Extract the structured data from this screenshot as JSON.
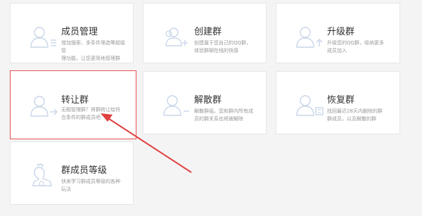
{
  "cards": [
    {
      "title": "成员管理",
      "desc": "增加搜索、多条件筛选等超级管\n理功能，让您更简地管理群"
    },
    {
      "title": "创建群",
      "desc": "创建属于您自己的QQ群，\n体验群聊在线的快感"
    },
    {
      "title": "升级群",
      "desc": "升级您的QQ群，吸纳更多\n成员加入"
    },
    {
      "title": "转让群",
      "desc": "无暇管理群？将群转让给符\n合条件的群成员吧"
    },
    {
      "title": "解散群",
      "desc": "解散群组。您和群内所有成\n员的群关系也将被解除"
    },
    {
      "title": "恢复群",
      "desc": "找回最近28天内删除的群\n群成员，以及解散的群"
    },
    {
      "title": "群成员等级",
      "desc": "快来学习群成员等级的各种\n玩法"
    }
  ],
  "colors": {
    "icon": "#c9d6e8",
    "highlight_border": "#e85050",
    "arrow": "#e04040"
  },
  "icons": [
    "user-list-icon",
    "user-add-icon",
    "user-upgrade-icon",
    "user-transfer-icon",
    "user-remove-icon",
    "user-restore-icon",
    "user-level-icon"
  ]
}
